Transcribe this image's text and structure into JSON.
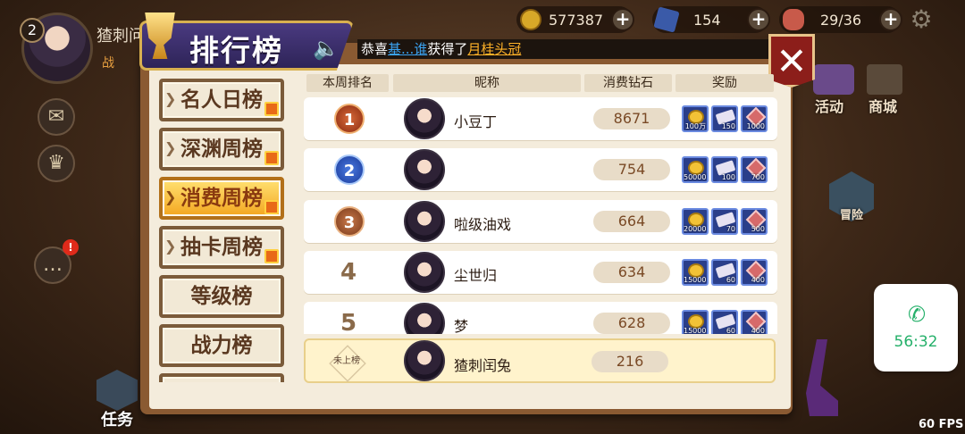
{
  "hud": {
    "level": "2",
    "player_name_top": "猹刺问",
    "clan_label": "战",
    "resources": [
      {
        "icon": "gold-coin-icon",
        "value": "577387"
      },
      {
        "icon": "blue-crystal-icon",
        "value": "154"
      },
      {
        "icon": "meat-stamina-icon",
        "value": "29/36"
      }
    ],
    "right_labels": {
      "activity": "活动",
      "shop": "商城",
      "adventure": "冒险"
    },
    "task_label": "任务"
  },
  "panel": {
    "title": "排行榜",
    "broadcast": {
      "prefix": "恭喜",
      "player": "基...谁",
      "middle": "获得了",
      "item": "月桂头冠"
    },
    "tabs": [
      {
        "label": "名人日榜",
        "gift": true,
        "active": false
      },
      {
        "label": "深渊周榜",
        "gift": true,
        "active": false
      },
      {
        "label": "消费周榜",
        "gift": true,
        "active": true
      },
      {
        "label": "抽卡周榜",
        "gift": true,
        "active": false
      },
      {
        "label": "等级榜",
        "gift": false,
        "active": false
      },
      {
        "label": "战力榜",
        "gift": false,
        "active": false
      }
    ],
    "columns": {
      "rank": "本周排名",
      "nickname": "昵称",
      "diamonds": "消费钻石",
      "reward": "奖励"
    },
    "rows": [
      {
        "rank": "1",
        "nickname": "小豆丁",
        "diamonds": "8671",
        "rewards": [
          "100万",
          "150",
          "1000"
        ]
      },
      {
        "rank": "2",
        "nickname": "",
        "diamonds": "754",
        "rewards": [
          "500000",
          "100",
          "700"
        ]
      },
      {
        "rank": "3",
        "nickname": "啦级油戏",
        "diamonds": "664",
        "rewards": [
          "200000",
          "70",
          "500"
        ]
      },
      {
        "rank": "4",
        "nickname": "尘世归",
        "diamonds": "634",
        "rewards": [
          "150000",
          "60",
          "400"
        ]
      },
      {
        "rank": "5",
        "nickname": "梦",
        "diamonds": "628",
        "rewards": [
          "150000",
          "60",
          "400"
        ]
      }
    ],
    "my_row": {
      "rank": "未上榜",
      "nickname": "猹刺闰兔",
      "diamonds": "216"
    }
  },
  "call": {
    "time": "56:32"
  },
  "fps": "60 FPS",
  "colors": {
    "active_tab": "#f3a620",
    "panel_frame": "#8a5a32",
    "close": "#8c1e1a",
    "call_green": "#25b06a"
  }
}
